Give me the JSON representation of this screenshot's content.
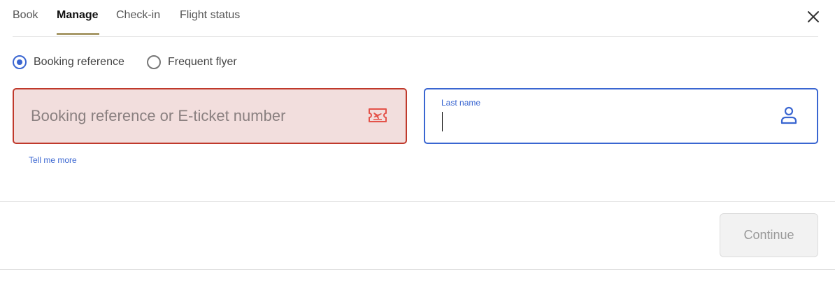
{
  "tabs": [
    {
      "label": "Book",
      "active": false
    },
    {
      "label": "Manage",
      "active": true
    },
    {
      "label": "Check-in",
      "active": false
    },
    {
      "label": "Flight status",
      "active": false
    }
  ],
  "close": {
    "icon": "close-icon"
  },
  "search_type": {
    "options": [
      {
        "label": "Booking reference",
        "selected": true
      },
      {
        "label": "Frequent flyer",
        "selected": false
      }
    ]
  },
  "booking_field": {
    "placeholder": "Booking reference or E-ticket number",
    "value": "",
    "state": "error",
    "icon": "ticket-icon"
  },
  "lastname_field": {
    "label": "Last name",
    "value": "",
    "state": "focused",
    "icon": "person-icon"
  },
  "help_link": "Tell me more",
  "continue_button": {
    "label": "Continue",
    "disabled": true
  },
  "colors": {
    "accent": "#3a66d1",
    "error_border": "#c0392b",
    "error_bg": "#f2dedd",
    "tab_underline": "#a89a6a"
  }
}
